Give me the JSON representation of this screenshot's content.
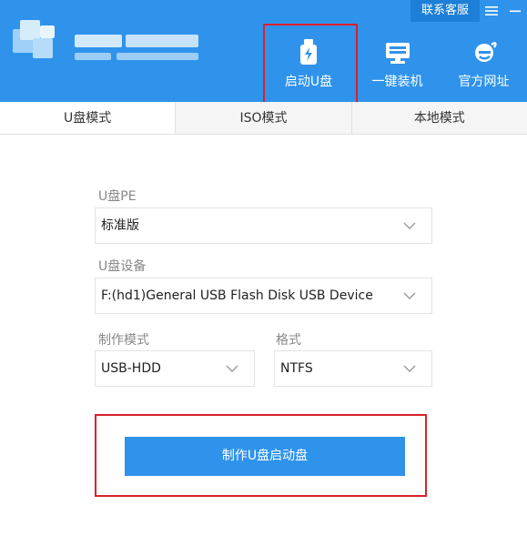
{
  "header": {
    "contact_label": "联系客服",
    "menu_icon": "menu-icon",
    "minimize_icon": "minimize-icon",
    "brand_color": "#2f93ec"
  },
  "nav": {
    "items": [
      {
        "label": "启动U盘",
        "icon": "usb-drive-icon",
        "active": true
      },
      {
        "label": "一键装机",
        "icon": "monitor-icon",
        "active": false
      },
      {
        "label": "官方网址",
        "icon": "browser-e-icon",
        "active": false
      }
    ]
  },
  "tabs": [
    {
      "label": "U盘模式",
      "active": true
    },
    {
      "label": "ISO模式",
      "active": false
    },
    {
      "label": "本地模式",
      "active": false
    }
  ],
  "form": {
    "pe_label": "U盘PE",
    "pe_value": "标准版",
    "device_label": "U盘设备",
    "device_value": "F:(hd1)General USB Flash Disk USB Device",
    "mode_label": "制作模式",
    "mode_value": "USB-HDD",
    "format_label": "格式",
    "format_value": "NTFS"
  },
  "action": {
    "make_label": "制作U盘启动盘",
    "highlight_color": "#d9202b"
  }
}
